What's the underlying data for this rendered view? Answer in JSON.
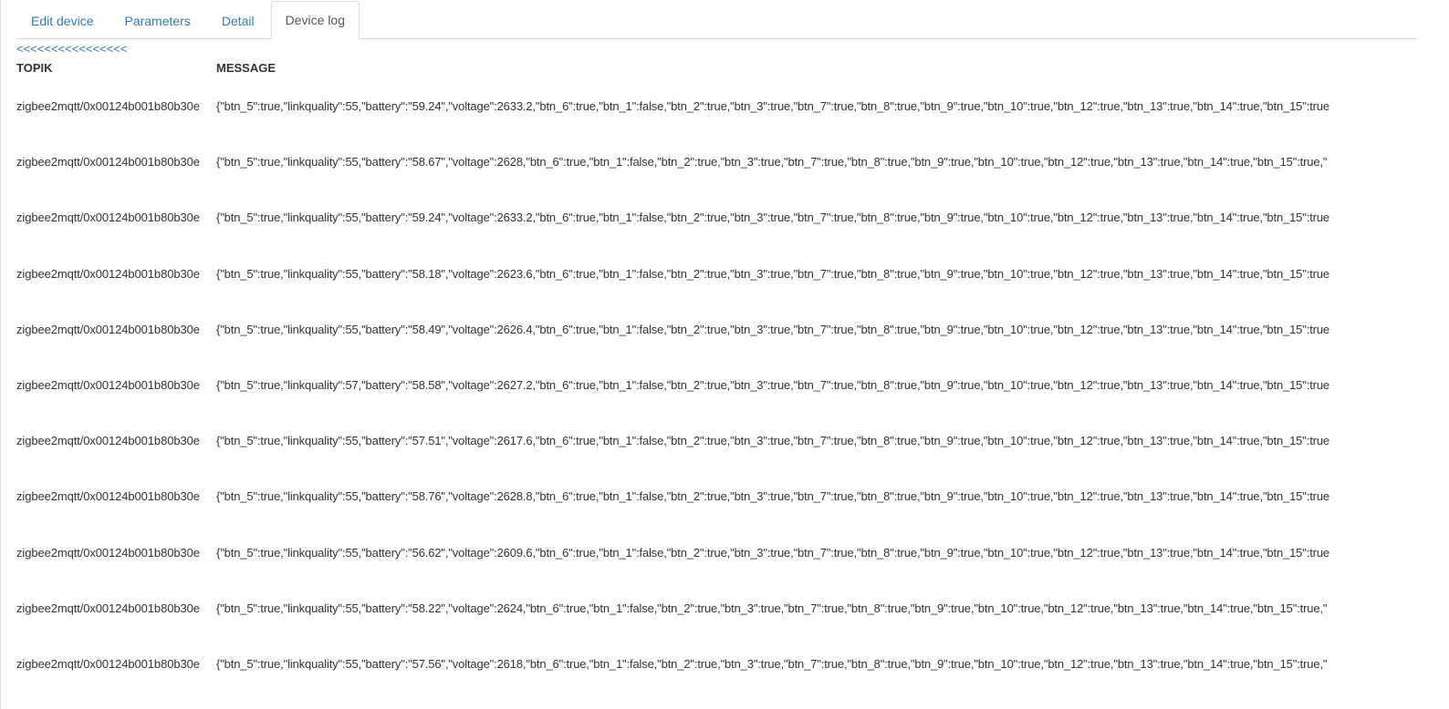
{
  "tabs": [
    {
      "label": "Edit device",
      "active": false
    },
    {
      "label": "Parameters",
      "active": false
    },
    {
      "label": "Detail",
      "active": false
    },
    {
      "label": "Device log",
      "active": true
    }
  ],
  "back_link": "<<<<<<<<<<<<<<<<",
  "table": {
    "headers": {
      "topic": "TOPIK",
      "message": "MESSAGE"
    },
    "rows": [
      {
        "topic": "zigbee2mqtt/0x00124b001b80b30e",
        "message": "{\"btn_5\":true,\"linkquality\":55,\"battery\":\"59.24\",\"voltage\":2633.2,\"btn_6\":true,\"btn_1\":false,\"btn_2\":true,\"btn_3\":true,\"btn_7\":true,\"btn_8\":true,\"btn_9\":true,\"btn_10\":true,\"btn_12\":true,\"btn_13\":true,\"btn_14\":true,\"btn_15\":true"
      },
      {
        "topic": "zigbee2mqtt/0x00124b001b80b30e",
        "message": "{\"btn_5\":true,\"linkquality\":55,\"battery\":\"58.67\",\"voltage\":2628,\"btn_6\":true,\"btn_1\":false,\"btn_2\":true,\"btn_3\":true,\"btn_7\":true,\"btn_8\":true,\"btn_9\":true,\"btn_10\":true,\"btn_12\":true,\"btn_13\":true,\"btn_14\":true,\"btn_15\":true,\""
      },
      {
        "topic": "zigbee2mqtt/0x00124b001b80b30e",
        "message": "{\"btn_5\":true,\"linkquality\":55,\"battery\":\"59.24\",\"voltage\":2633.2,\"btn_6\":true,\"btn_1\":false,\"btn_2\":true,\"btn_3\":true,\"btn_7\":true,\"btn_8\":true,\"btn_9\":true,\"btn_10\":true,\"btn_12\":true,\"btn_13\":true,\"btn_14\":true,\"btn_15\":true"
      },
      {
        "topic": "zigbee2mqtt/0x00124b001b80b30e",
        "message": "{\"btn_5\":true,\"linkquality\":55,\"battery\":\"58.18\",\"voltage\":2623.6,\"btn_6\":true,\"btn_1\":false,\"btn_2\":true,\"btn_3\":true,\"btn_7\":true,\"btn_8\":true,\"btn_9\":true,\"btn_10\":true,\"btn_12\":true,\"btn_13\":true,\"btn_14\":true,\"btn_15\":true"
      },
      {
        "topic": "zigbee2mqtt/0x00124b001b80b30e",
        "message": "{\"btn_5\":true,\"linkquality\":55,\"battery\":\"58.49\",\"voltage\":2626.4,\"btn_6\":true,\"btn_1\":false,\"btn_2\":true,\"btn_3\":true,\"btn_7\":true,\"btn_8\":true,\"btn_9\":true,\"btn_10\":true,\"btn_12\":true,\"btn_13\":true,\"btn_14\":true,\"btn_15\":true"
      },
      {
        "topic": "zigbee2mqtt/0x00124b001b80b30e",
        "message": "{\"btn_5\":true,\"linkquality\":57,\"battery\":\"58.58\",\"voltage\":2627.2,\"btn_6\":true,\"btn_1\":false,\"btn_2\":true,\"btn_3\":true,\"btn_7\":true,\"btn_8\":true,\"btn_9\":true,\"btn_10\":true,\"btn_12\":true,\"btn_13\":true,\"btn_14\":true,\"btn_15\":true"
      },
      {
        "topic": "zigbee2mqtt/0x00124b001b80b30e",
        "message": "{\"btn_5\":true,\"linkquality\":55,\"battery\":\"57.51\",\"voltage\":2617.6,\"btn_6\":true,\"btn_1\":false,\"btn_2\":true,\"btn_3\":true,\"btn_7\":true,\"btn_8\":true,\"btn_9\":true,\"btn_10\":true,\"btn_12\":true,\"btn_13\":true,\"btn_14\":true,\"btn_15\":true"
      },
      {
        "topic": "zigbee2mqtt/0x00124b001b80b30e",
        "message": "{\"btn_5\":true,\"linkquality\":55,\"battery\":\"58.76\",\"voltage\":2628.8,\"btn_6\":true,\"btn_1\":false,\"btn_2\":true,\"btn_3\":true,\"btn_7\":true,\"btn_8\":true,\"btn_9\":true,\"btn_10\":true,\"btn_12\":true,\"btn_13\":true,\"btn_14\":true,\"btn_15\":true"
      },
      {
        "topic": "zigbee2mqtt/0x00124b001b80b30e",
        "message": "{\"btn_5\":true,\"linkquality\":55,\"battery\":\"56.62\",\"voltage\":2609.6,\"btn_6\":true,\"btn_1\":false,\"btn_2\":true,\"btn_3\":true,\"btn_7\":true,\"btn_8\":true,\"btn_9\":true,\"btn_10\":true,\"btn_12\":true,\"btn_13\":true,\"btn_14\":true,\"btn_15\":true"
      },
      {
        "topic": "zigbee2mqtt/0x00124b001b80b30e",
        "message": "{\"btn_5\":true,\"linkquality\":55,\"battery\":\"58.22\",\"voltage\":2624,\"btn_6\":true,\"btn_1\":false,\"btn_2\":true,\"btn_3\":true,\"btn_7\":true,\"btn_8\":true,\"btn_9\":true,\"btn_10\":true,\"btn_12\":true,\"btn_13\":true,\"btn_14\":true,\"btn_15\":true,\""
      },
      {
        "topic": "zigbee2mqtt/0x00124b001b80b30e",
        "message": "{\"btn_5\":true,\"linkquality\":55,\"battery\":\"57.56\",\"voltage\":2618,\"btn_6\":true,\"btn_1\":false,\"btn_2\":true,\"btn_3\":true,\"btn_7\":true,\"btn_8\":true,\"btn_9\":true,\"btn_10\":true,\"btn_12\":true,\"btn_13\":true,\"btn_14\":true,\"btn_15\":true,\""
      }
    ]
  }
}
